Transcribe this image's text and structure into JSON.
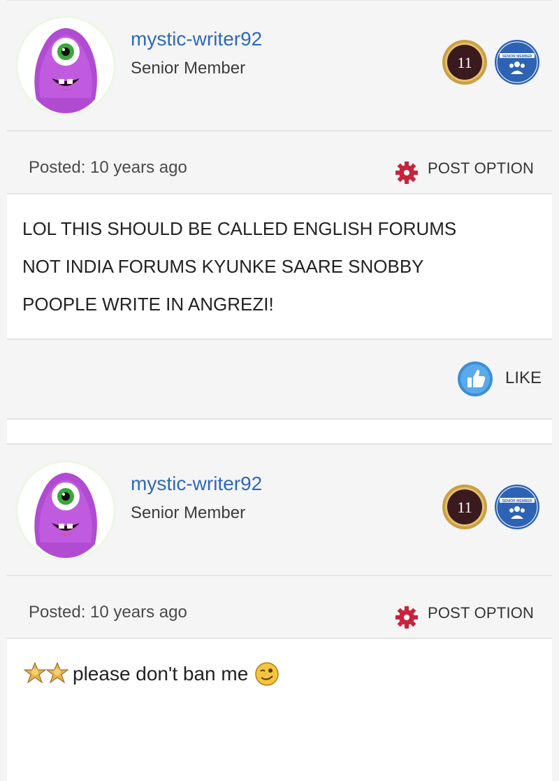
{
  "posts": [
    {
      "username": "mystic-writer92",
      "rank": "Senior Member",
      "posted": "Posted: 10 years ago",
      "option": "POST OPTION",
      "body_lines": [
        "LOL THIS SHOULD BE CALLED ENGLISH FORUMS",
        "NOT INDIA FORUMS KYUNKE SAARE SNOBBY",
        "POOPLE WRITE IN ANGREZI!"
      ],
      "like": "LIKE",
      "badge_years": "11",
      "badge_member": "SENIOR MEMBER"
    },
    {
      "username": "mystic-writer92",
      "rank": "Senior Member",
      "posted": "Posted: 10 years ago",
      "option": "POST OPTION",
      "body_text": "please don't ban me",
      "badge_years": "11",
      "badge_member": "SENIOR MEMBER"
    }
  ],
  "colors": {
    "username": "#2f69b9",
    "gear": "#c8243c",
    "like": "#3b8fd6",
    "badge_gold": "#c9a044",
    "badge_blue": "#2e63b3"
  }
}
